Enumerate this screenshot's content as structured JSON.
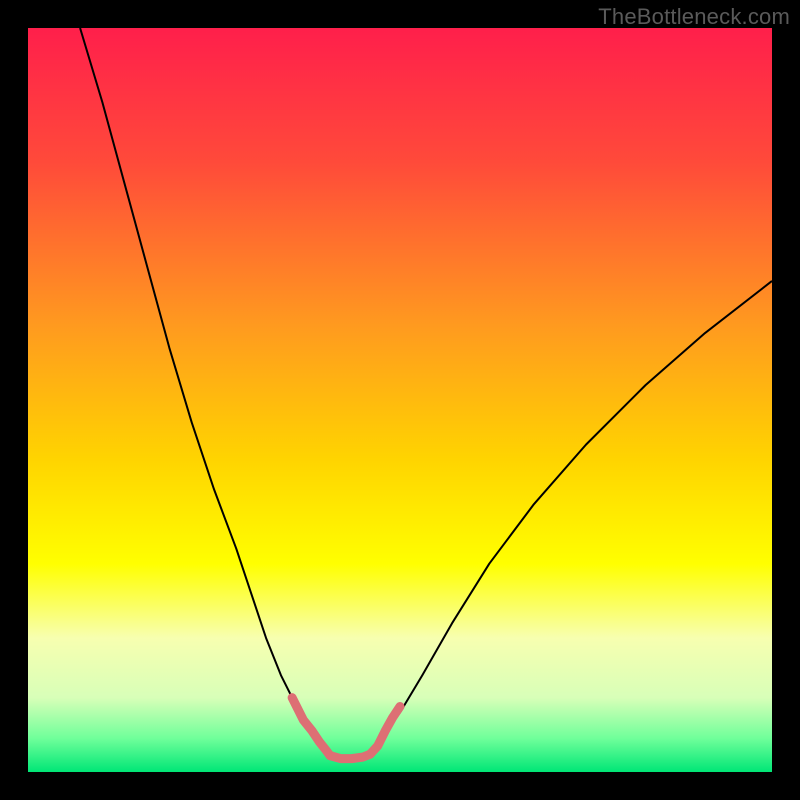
{
  "watermark": "TheBottleneck.com",
  "chart_data": {
    "type": "line",
    "title": "",
    "xlabel": "",
    "ylabel": "",
    "xlim": [
      0,
      100
    ],
    "ylim": [
      0,
      100
    ],
    "grid": false,
    "legend": false,
    "background_gradient": {
      "stops": [
        {
          "offset": 0.0,
          "color": "#ff1f4b"
        },
        {
          "offset": 0.18,
          "color": "#ff4a3a"
        },
        {
          "offset": 0.4,
          "color": "#ff9a1f"
        },
        {
          "offset": 0.58,
          "color": "#ffd400"
        },
        {
          "offset": 0.72,
          "color": "#ffff00"
        },
        {
          "offset": 0.82,
          "color": "#f7ffb0"
        },
        {
          "offset": 0.9,
          "color": "#d8ffb8"
        },
        {
          "offset": 0.955,
          "color": "#6fff9a"
        },
        {
          "offset": 1.0,
          "color": "#00e676"
        }
      ]
    },
    "series": [
      {
        "name": "left-curve",
        "color": "#000000",
        "width": 2,
        "x": [
          7,
          10,
          13,
          16,
          19,
          22,
          25,
          28,
          30,
          32,
          34,
          35.5,
          37,
          38.2
        ],
        "y": [
          100,
          90,
          79,
          68,
          57,
          47,
          38,
          30,
          24,
          18,
          13,
          10,
          7,
          5.5
        ]
      },
      {
        "name": "right-curve",
        "color": "#000000",
        "width": 2,
        "x": [
          48,
          50,
          53,
          57,
          62,
          68,
          75,
          83,
          91,
          100
        ],
        "y": [
          5.5,
          8,
          13,
          20,
          28,
          36,
          44,
          52,
          59,
          66
        ]
      },
      {
        "name": "left-handle",
        "color": "#dd6f74",
        "width": 9,
        "cap": "round",
        "x": [
          35.5,
          37,
          38.2,
          39.2,
          40,
          40.6
        ],
        "y": [
          10,
          7,
          5.5,
          4,
          3,
          2.2
        ]
      },
      {
        "name": "right-handle",
        "color": "#dd6f74",
        "width": 9,
        "cap": "round",
        "x": [
          46,
          47,
          48,
          49,
          50
        ],
        "y": [
          2.4,
          3.5,
          5.5,
          7.3,
          8.8
        ]
      },
      {
        "name": "bottom-handle",
        "color": "#dd6f74",
        "width": 9,
        "cap": "round",
        "x": [
          40.6,
          42,
          43.5,
          45,
          46
        ],
        "y": [
          2.2,
          1.8,
          1.8,
          2.0,
          2.4
        ]
      }
    ]
  }
}
